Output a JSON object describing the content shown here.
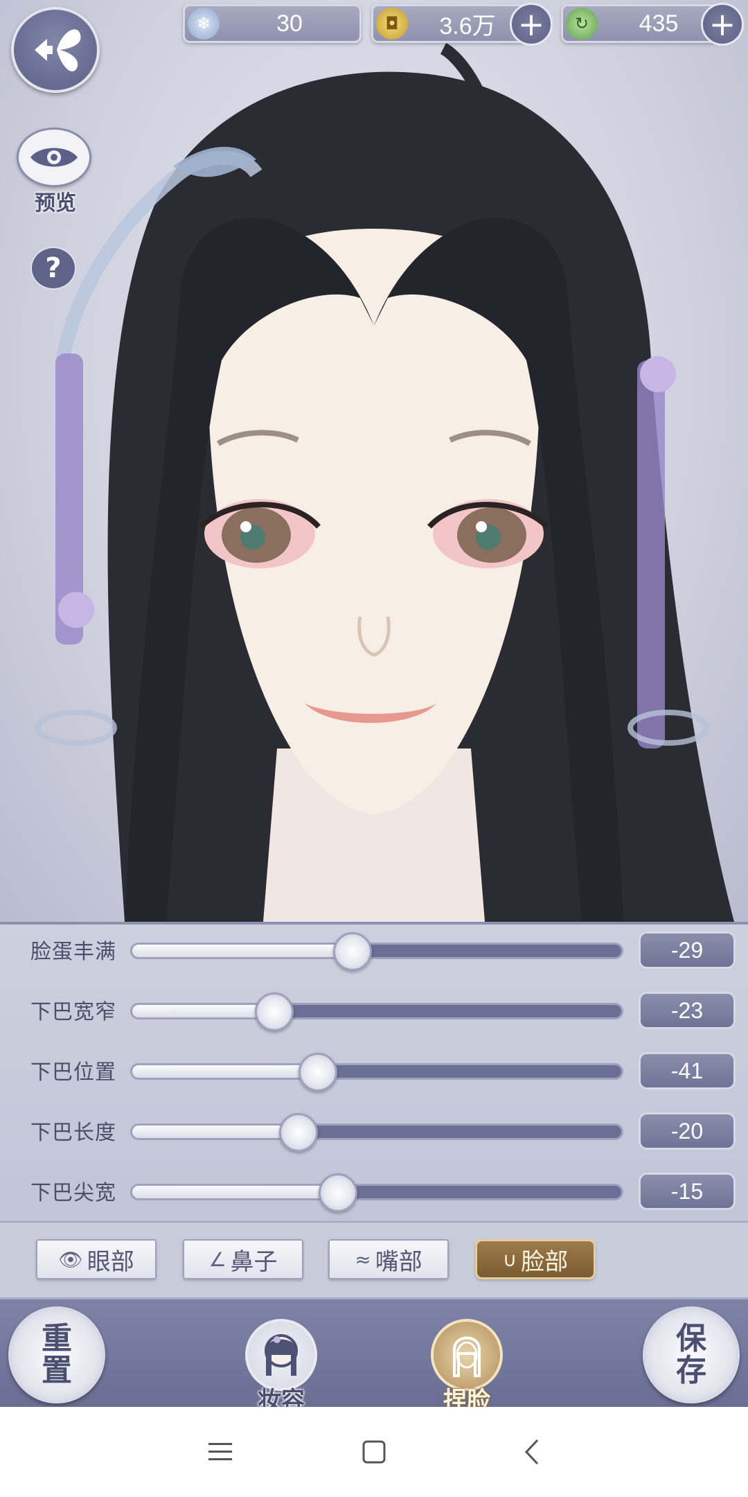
{
  "currency": {
    "jade": {
      "icon": "jade-orb-icon",
      "value": "30"
    },
    "coins": {
      "icon": "copper-coin-icon",
      "value": "3.6万"
    },
    "energy": {
      "icon": "green-leaf-icon",
      "value": "435"
    }
  },
  "sidebar": {
    "preview_label": "预览",
    "help_label": "?"
  },
  "sliders": [
    {
      "label": "脸蛋丰满",
      "value": "-29",
      "level": 0.45
    },
    {
      "label": "下巴宽窄",
      "value": "-23",
      "level": 0.29
    },
    {
      "label": "下巴位置",
      "value": "-41",
      "level": 0.38
    },
    {
      "label": "下巴长度",
      "value": "-20",
      "level": 0.34
    },
    {
      "label": "下巴尖宽",
      "value": "-15",
      "level": 0.42
    }
  ],
  "tabs": [
    {
      "label": "眼部",
      "icon": "eye-icon",
      "active": false
    },
    {
      "label": "鼻子",
      "icon": "nose-icon",
      "active": false
    },
    {
      "label": "嘴部",
      "icon": "mouth-icon",
      "active": false
    },
    {
      "label": "脸部",
      "icon": "face-curve-icon",
      "active": true
    }
  ],
  "bottom": {
    "reset_label": "重置",
    "makeup_label": "妆容",
    "face_label": "捏脸",
    "save_label": "保存"
  },
  "colors": {
    "accent": "#6b6f93",
    "active_tab": "#8b6a3e",
    "panel": "#c8cbda"
  }
}
